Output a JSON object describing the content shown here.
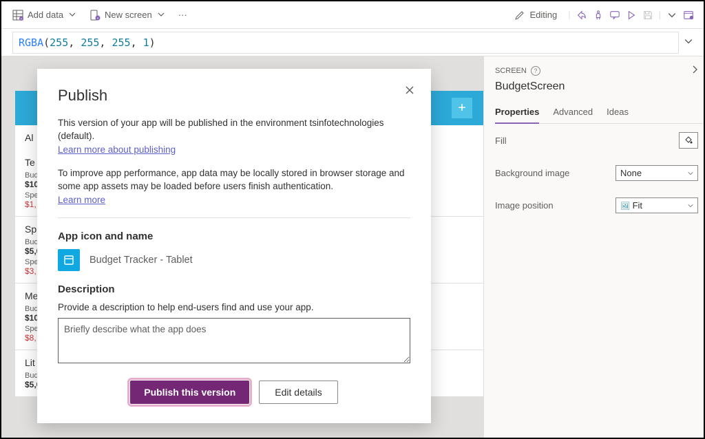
{
  "toolbar": {
    "add_data": "Add data",
    "new_screen": "New screen",
    "more": "···",
    "editing": "Editing"
  },
  "formula": {
    "func": "RGBA",
    "args": [
      "255",
      "255",
      "255",
      "1"
    ]
  },
  "canvas": {
    "al_text": "Al",
    "rows": [
      {
        "cat": "Te",
        "bud": "Bud",
        "amt": "$10",
        "spent": "Spe",
        "spamt": "$1,"
      },
      {
        "cat": "Sp",
        "bud": "Bud",
        "amt": "$5,0",
        "spent": "Spe",
        "spamt": "$3,"
      },
      {
        "cat": "Me",
        "bud": "Bud",
        "amt": "$10",
        "spent": "Spe",
        "spamt": "$8,"
      },
      {
        "cat": "Lit",
        "bud": "Bud",
        "amt": "$5,0",
        "spent": "",
        "spamt": ""
      }
    ]
  },
  "panel": {
    "header_label": "SCREEN",
    "screen_name": "BudgetScreen",
    "tabs": {
      "properties": "Properties",
      "advanced": "Advanced",
      "ideas": "Ideas"
    },
    "fill_label": "Fill",
    "bg_label": "Background image",
    "bg_value": "None",
    "imgpos_label": "Image position",
    "imgpos_value": "Fit"
  },
  "dialog": {
    "title": "Publish",
    "line1": "This version of your app will be published in the environment tsinfotechnologies (default).",
    "learn_publish": "Learn more about publishing",
    "line2": "To improve app performance, app data may be locally stored in browser storage and some app assets may be loaded before users finish authentication.",
    "learn_more": "Learn more",
    "section_icon": "App icon and name",
    "app_name": "Budget Tracker - Tablet",
    "section_desc": "Description",
    "desc_sub": "Provide a description to help end-users find and use your app.",
    "desc_placeholder": "Briefly describe what the app does",
    "btn_primary": "Publish this version",
    "btn_secondary": "Edit details"
  }
}
